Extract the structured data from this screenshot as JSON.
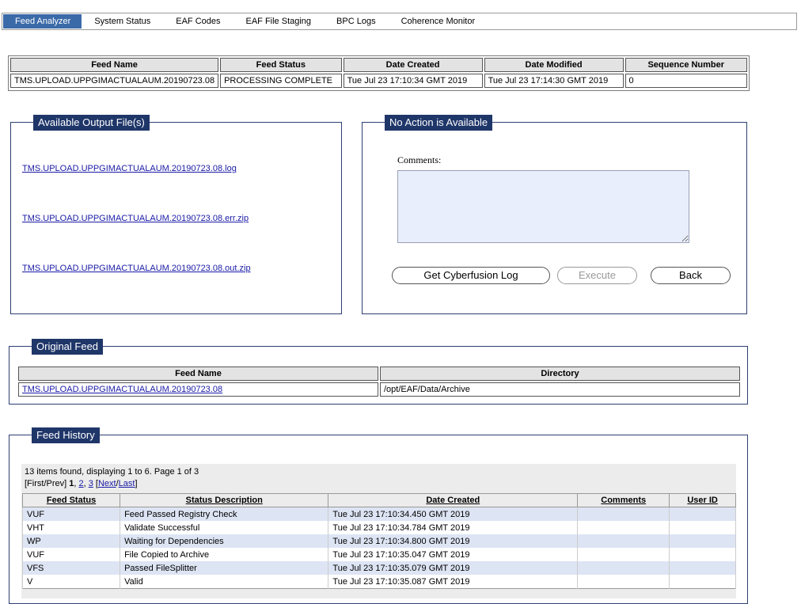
{
  "nav": {
    "tabs": [
      "Feed Analyzer",
      "System Status",
      "EAF Codes",
      "EAF File Staging",
      "BPC Logs",
      "Coherence Monitor"
    ],
    "active": "Feed Analyzer"
  },
  "summary": {
    "headers": [
      "Feed Name",
      "Feed Status",
      "Date Created",
      "Date Modified",
      "Sequence Number"
    ],
    "row": [
      "TMS.UPLOAD.UPPGIMACTUALAUM.20190723.08",
      "PROCESSING COMPLETE",
      "Tue Jul 23 17:10:34 GMT 2019",
      "Tue Jul 23 17:14:30 GMT 2019",
      "0"
    ]
  },
  "output_files": {
    "legend": "Available Output File(s)",
    "files": [
      "TMS.UPLOAD.UPPGIMACTUALAUM.20190723.08.log",
      "TMS.UPLOAD.UPPGIMACTUALAUM.20190723.08.err.zip",
      "TMS.UPLOAD.UPPGIMACTUALAUM.20190723.08.out.zip"
    ]
  },
  "action": {
    "legend": "No Action is Available",
    "comments_label": "Comments:",
    "comments_value": "",
    "buttons": {
      "cyberfusion": "Get Cyberfusion Log",
      "execute": "Execute",
      "back": "Back"
    }
  },
  "original_feed": {
    "legend": "Original Feed",
    "headers": [
      "Feed Name",
      "Directory"
    ],
    "row": [
      "TMS.UPLOAD.UPPGIMACTUALAUM.20190723.08",
      "/opt/EAF/Data/Archive"
    ]
  },
  "history": {
    "legend": "Feed History",
    "summary": "13 items found, displaying 1 to 6. Page 1 of 3",
    "pager": {
      "first_prev": "[First/Prev]",
      "current": "1",
      "page2": "2",
      "page3": "3",
      "next_last_open": "[",
      "next": "Next",
      "slash": "/",
      "last": "Last",
      "close": "]"
    },
    "headers": [
      "Feed Status",
      "Status Description",
      "Date Created",
      "Comments",
      "User ID"
    ],
    "rows": [
      [
        "VUF",
        "Feed Passed Registry Check",
        "Tue Jul 23 17:10:34.450 GMT 2019",
        "",
        ""
      ],
      [
        "VHT",
        "Validate Successful",
        "Tue Jul 23 17:10:34.784 GMT 2019",
        "",
        ""
      ],
      [
        "WP",
        "Waiting for Dependencies",
        "Tue Jul 23 17:10:34.800 GMT 2019",
        "",
        ""
      ],
      [
        "VUF",
        "File Copied to Archive",
        "Tue Jul 23 17:10:35.047 GMT 2019",
        "",
        ""
      ],
      [
        "VFS",
        "Passed FileSplitter",
        "Tue Jul 23 17:10:35.079 GMT 2019",
        "",
        ""
      ],
      [
        "V",
        "Valid",
        "Tue Jul 23 17:10:35.087 GMT 2019",
        "",
        ""
      ]
    ]
  }
}
